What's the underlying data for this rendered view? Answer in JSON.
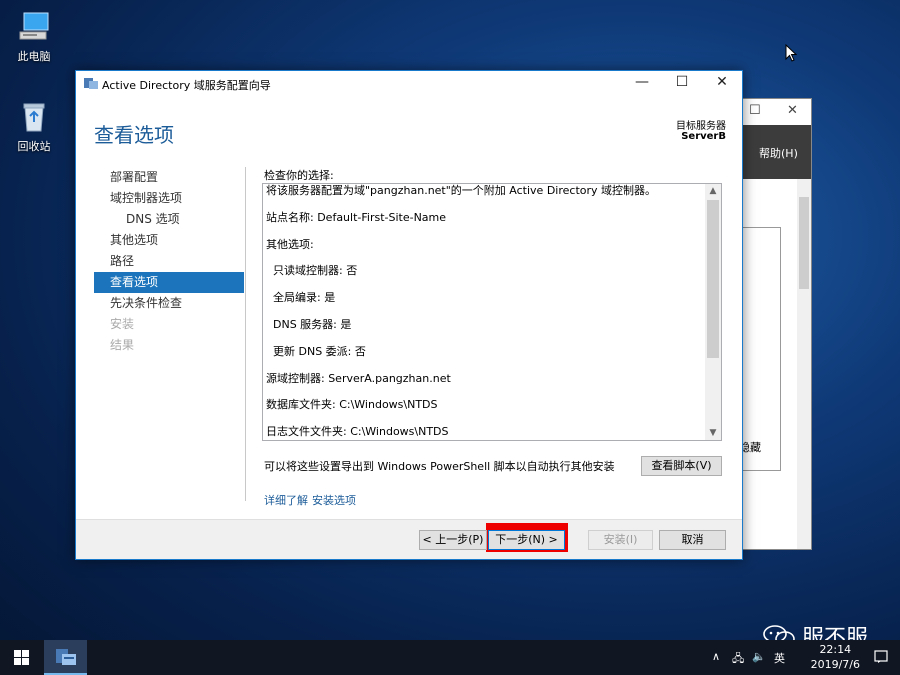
{
  "desktop": {
    "icons": [
      {
        "label": "此电脑",
        "icon": "computer-icon"
      },
      {
        "label": "回收站",
        "icon": "recycle-bin-icon"
      }
    ]
  },
  "background_window": {
    "menu_label": "帮助(H)",
    "hidden_label": "隐藏"
  },
  "wizard": {
    "window_title": "Active Directory 域服务配置向导",
    "page_title": "查看选项",
    "target_server_label": "目标服务器",
    "target_server_name": "ServerB",
    "nav": [
      {
        "label": "部署配置",
        "state": "normal"
      },
      {
        "label": "域控制器选项",
        "state": "normal"
      },
      {
        "label": "DNS 选项",
        "state": "sub"
      },
      {
        "label": "其他选项",
        "state": "normal"
      },
      {
        "label": "路径",
        "state": "normal"
      },
      {
        "label": "查看选项",
        "state": "active"
      },
      {
        "label": "先决条件检查",
        "state": "normal"
      },
      {
        "label": "安装",
        "state": "disabled"
      },
      {
        "label": "结果",
        "state": "disabled"
      }
    ],
    "review_label": "检查你的选择:",
    "review_lines": [
      "将该服务器配置为域\"pangzhan.net\"的一个附加 Active Directory 域控制器。",
      "站点名称: Default-First-Site-Name",
      "其他选项:",
      "只读域控制器: 否",
      "全局编录: 是",
      "DNS 服务器: 是",
      "更新 DNS 委派: 否",
      "源域控制器: ServerA.pangzhan.net",
      "数据库文件夹: C:\\Windows\\NTDS",
      "日志文件文件夹: C:\\Windows\\NTDS"
    ],
    "export_text": "可以将这些设置导出到 Windows PowerShell 脚本以自动执行其他安装",
    "view_script_button": "查看脚本(V)",
    "link_more": "详细了解",
    "link_install_options": "安装选项",
    "buttons": {
      "previous": "< 上一步(P)",
      "next": "下一步(N) >",
      "install": "安装(I)",
      "cancel": "取消"
    },
    "highlight_color": "#ee0000",
    "accent_color": "#1c75bc"
  },
  "watermark": {
    "text": "服不服"
  },
  "taskbar": {
    "language": "英",
    "time": "22:14",
    "date": "2019/7/6"
  }
}
